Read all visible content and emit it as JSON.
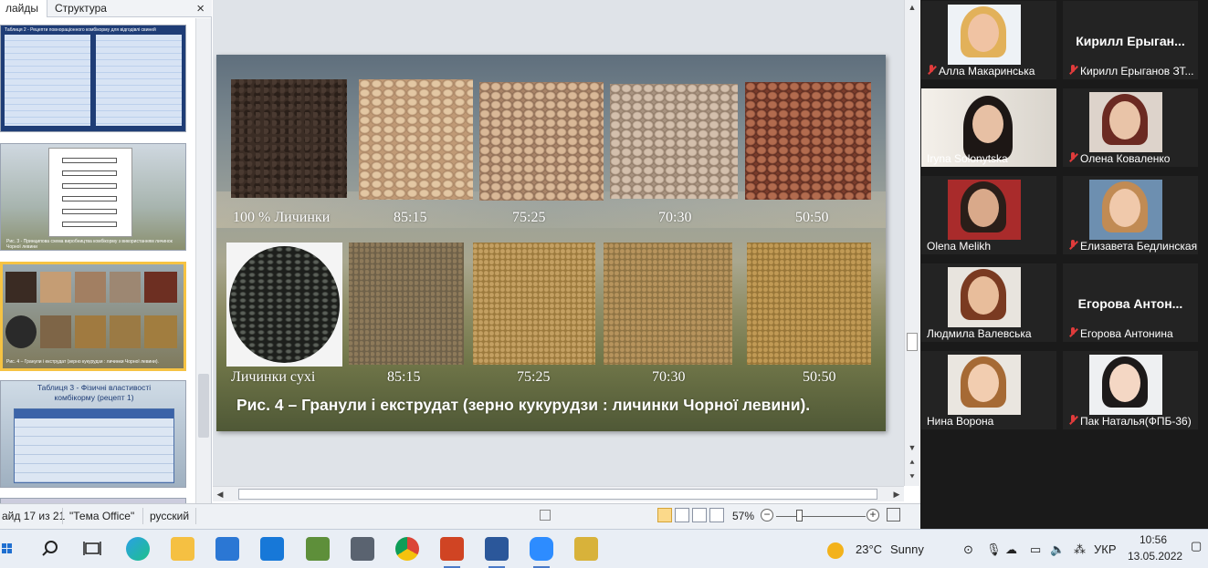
{
  "slides_pane": {
    "tab_slides": "лайды",
    "tab_structure": "Структура",
    "close": "×",
    "slide1_title": "Таблиця 2 - Рецепти повнораціонного комбікорму для відгодівлі свиней",
    "slide2_caption": "Рис. 3 - Принципова схема виробництва комбікорму з використанням личинок Чорної левини",
    "slide3_caption": "Рис. 4 – Гранули і екструдат (зерно кукурудзи : личинки Чорної левини).",
    "slide4_title": "Таблиця 3 - Фізичні властивості комбікорму (рецепт 1)"
  },
  "slide": {
    "row1_labels": [
      "100 % Личинки",
      "85:15",
      "75:25",
      "70:30",
      "50:50"
    ],
    "row2_labels": [
      "Личинки сухі",
      "85:15",
      "75:25",
      "70:30",
      "50:50"
    ],
    "caption": "Рис. 4 – Гранули і екструдат (зерно кукурудзи : личинки Чорної левини)."
  },
  "status_bar": {
    "slide_counter": "айд 17 из 21",
    "theme": "\"Тема Office\"",
    "language": "русский",
    "zoom": "57%"
  },
  "participants": [
    {
      "name": "Алла Макаринська",
      "muted": true,
      "video": true
    },
    {
      "name": "Кирилл Ерыганов ЗТ...",
      "big": "Кирилл  Ерыган...",
      "muted": true,
      "video": false
    },
    {
      "name": "Iryna Solonytska",
      "muted": false,
      "video": true
    },
    {
      "name": "Олена Коваленко",
      "muted": true,
      "video": true
    },
    {
      "name": "Olena Melikh",
      "muted": false,
      "video": true
    },
    {
      "name": "Елизавета Бедлинская",
      "muted": true,
      "video": true
    },
    {
      "name": "Людмила Валевська",
      "muted": false,
      "video": true
    },
    {
      "name": "Егорова Антонина",
      "big": "Егорова  Антон...",
      "muted": true,
      "video": false
    },
    {
      "name": "Нина Ворона",
      "muted": false,
      "video": true
    },
    {
      "name": "Пак Наталья(ФПБ-36)",
      "muted": true,
      "video": true
    }
  ],
  "taskbar": {
    "weather_temp": "23°C",
    "weather_text": "Sunny",
    "language": "УКР",
    "time": "10:56",
    "date": "13.05.2022"
  },
  "colors": {
    "slide_selected_border": "#f6c343",
    "mute_red": "#e03b3b",
    "zoom_bg": "#1a1a1a"
  }
}
